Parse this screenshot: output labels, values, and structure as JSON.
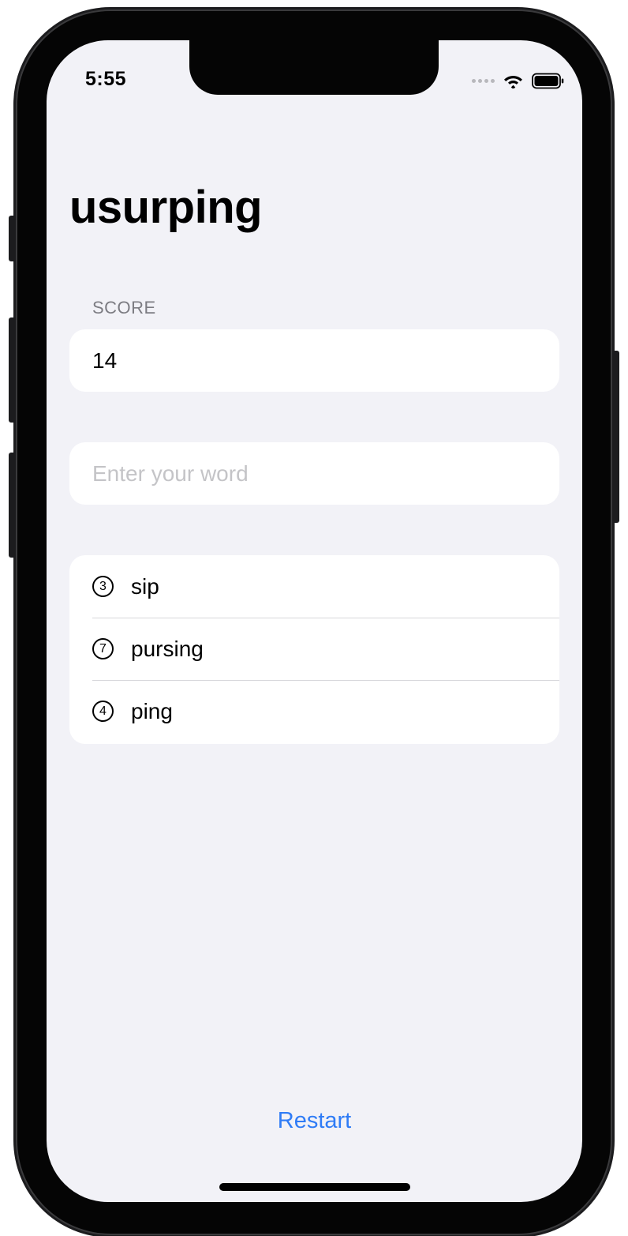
{
  "status_bar": {
    "time": "5:55",
    "icons": [
      "cellular-signal-icon",
      "wifi-icon",
      "battery-icon"
    ]
  },
  "page": {
    "title": "usurping"
  },
  "score": {
    "header": "SCORE",
    "value": "14"
  },
  "input": {
    "placeholder": "Enter your word",
    "value": ""
  },
  "words": [
    {
      "count": "3",
      "word": "sip"
    },
    {
      "count": "7",
      "word": "pursing"
    },
    {
      "count": "4",
      "word": "ping"
    }
  ],
  "toolbar": {
    "restart_label": "Restart"
  },
  "colors": {
    "background": "#f2f2f7",
    "card": "#ffffff",
    "accent": "#2f7cf6",
    "placeholder": "#c4c4c7",
    "secondary_text": "#7c7c82"
  }
}
